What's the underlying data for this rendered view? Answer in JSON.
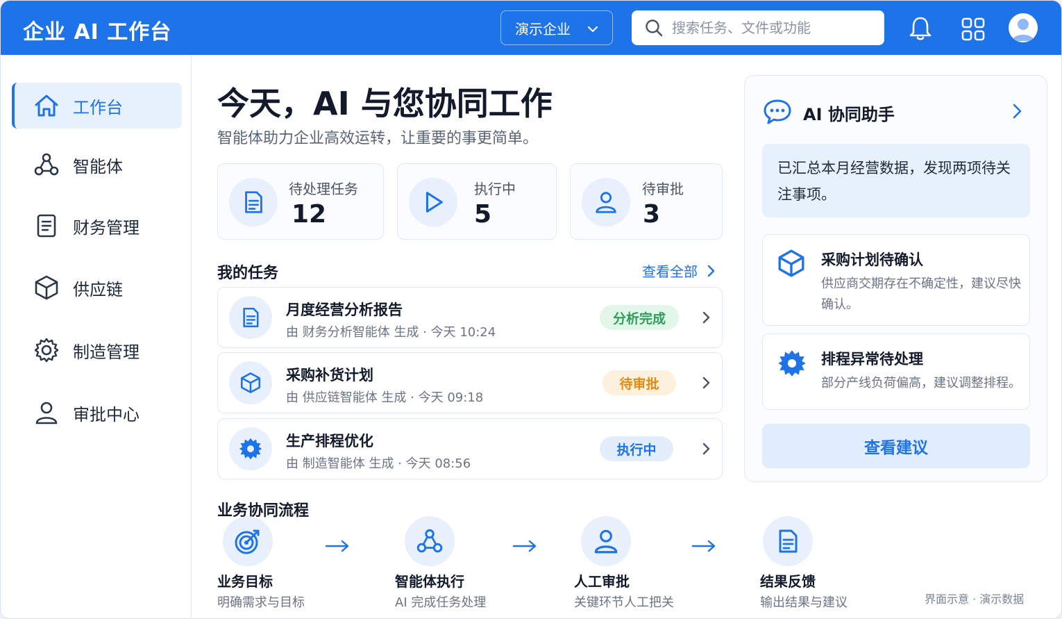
{
  "header": {
    "brand": "企业 AI 工作台",
    "org_select": "演示企业",
    "search_placeholder": "搜索任务、文件或功能"
  },
  "sidebar": {
    "items": [
      {
        "label": "工作台",
        "icon": "home-icon",
        "active": true
      },
      {
        "label": "智能体",
        "icon": "agent-icon",
        "active": false
      },
      {
        "label": "财务管理",
        "icon": "document-icon",
        "active": false
      },
      {
        "label": "供应链",
        "icon": "cube-icon",
        "active": false
      },
      {
        "label": "制造管理",
        "icon": "gear-icon",
        "active": false
      },
      {
        "label": "审批中心",
        "icon": "user-icon",
        "active": false
      }
    ]
  },
  "main": {
    "title": "今天，AI 与您协同工作",
    "subtitle": "智能体助力企业高效运转，让重要的事更简单。",
    "stats": [
      {
        "label": "待处理任务",
        "value": "12",
        "icon": "document-icon"
      },
      {
        "label": "执行中",
        "value": "5",
        "icon": "play-icon"
      },
      {
        "label": "待审批",
        "value": "3",
        "icon": "user-icon"
      }
    ],
    "tasks_title": "我的任务",
    "view_all": "查看全部",
    "tasks": [
      {
        "title": "月度经营分析报告",
        "meta": "由 财务分析智能体 生成 · 今天 10:24",
        "status": "分析完成",
        "status_color": "#2e9e5b",
        "status_bg": "#e3f6ea",
        "icon": "document-icon"
      },
      {
        "title": "采购补货计划",
        "meta": "由 供应链智能体 生成 · 今天 09:18",
        "status": "待审批",
        "status_color": "#e58a12",
        "status_bg": "#fdf0dc",
        "icon": "cube-icon"
      },
      {
        "title": "生产排程优化",
        "meta": "由 制造智能体 生成 · 今天 08:56",
        "status": "执行中",
        "status_color": "#1f73e8",
        "status_bg": "#e3edfc",
        "icon": "gear-icon"
      }
    ],
    "flow_title": "业务协同流程",
    "flow": [
      {
        "title": "业务目标",
        "sub": "明确需求与目标",
        "icon": "target-icon"
      },
      {
        "title": "智能体执行",
        "sub": "AI 完成任务处理",
        "icon": "agent-icon"
      },
      {
        "title": "人工审批",
        "sub": "关键环节人工把关",
        "icon": "user-icon"
      },
      {
        "title": "结果反馈",
        "sub": "输出结果与建议",
        "icon": "document-icon"
      }
    ]
  },
  "assistant": {
    "title": "AI 协同助手",
    "message": "已汇总本月经营数据，发现两项待关注事项。",
    "insights": [
      {
        "title": "采购计划待确认",
        "desc": "供应商交期存在不确定性，建议尽快确认。",
        "icon": "cube-icon"
      },
      {
        "title": "排程异常待处理",
        "desc": "部分产线负荷偏高，建议调整排程。",
        "icon": "gear-icon"
      }
    ],
    "button": "查看建议"
  },
  "footnote": "界面示意 · 演示数据",
  "colors": {
    "primary": "#1f73e8",
    "text": "#121a2b"
  }
}
